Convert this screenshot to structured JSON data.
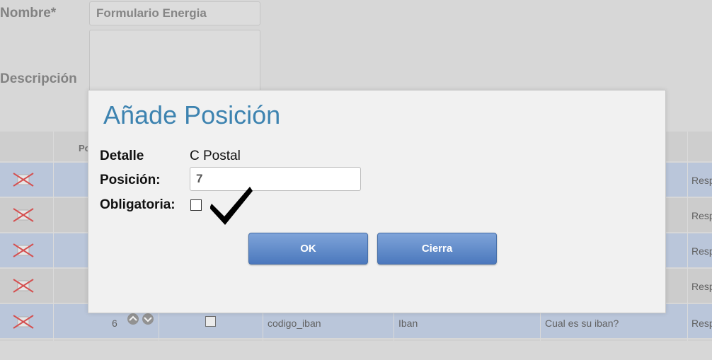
{
  "form": {
    "name_label": "Nombre*",
    "name_value": "Formulario Energia",
    "description_label": "Descripción"
  },
  "table": {
    "header_position": "Po",
    "visible_row": {
      "position": "6",
      "field": "codigo_iban",
      "label": "Iban",
      "question": "Cual es su iban?",
      "type": "Resp"
    },
    "right_col_cells": [
      "Resp",
      "Resp",
      "Resp",
      "Resp"
    ]
  },
  "dialog": {
    "title": "Añade Posición",
    "detail_label": "Detalle",
    "detail_value": "C Postal",
    "position_label": "Posición:",
    "position_value": "7",
    "required_label": "Obligatoria:",
    "ok_label": "OK",
    "close_label": "Cierra"
  },
  "icons": [
    "delete-icon",
    "up-arrow-icon",
    "down-arrow-icon",
    "checkmark-icon"
  ],
  "colors": {
    "title": "#3d83b0",
    "button": "#5b86c8",
    "row_blue": "#c5d1e6"
  }
}
